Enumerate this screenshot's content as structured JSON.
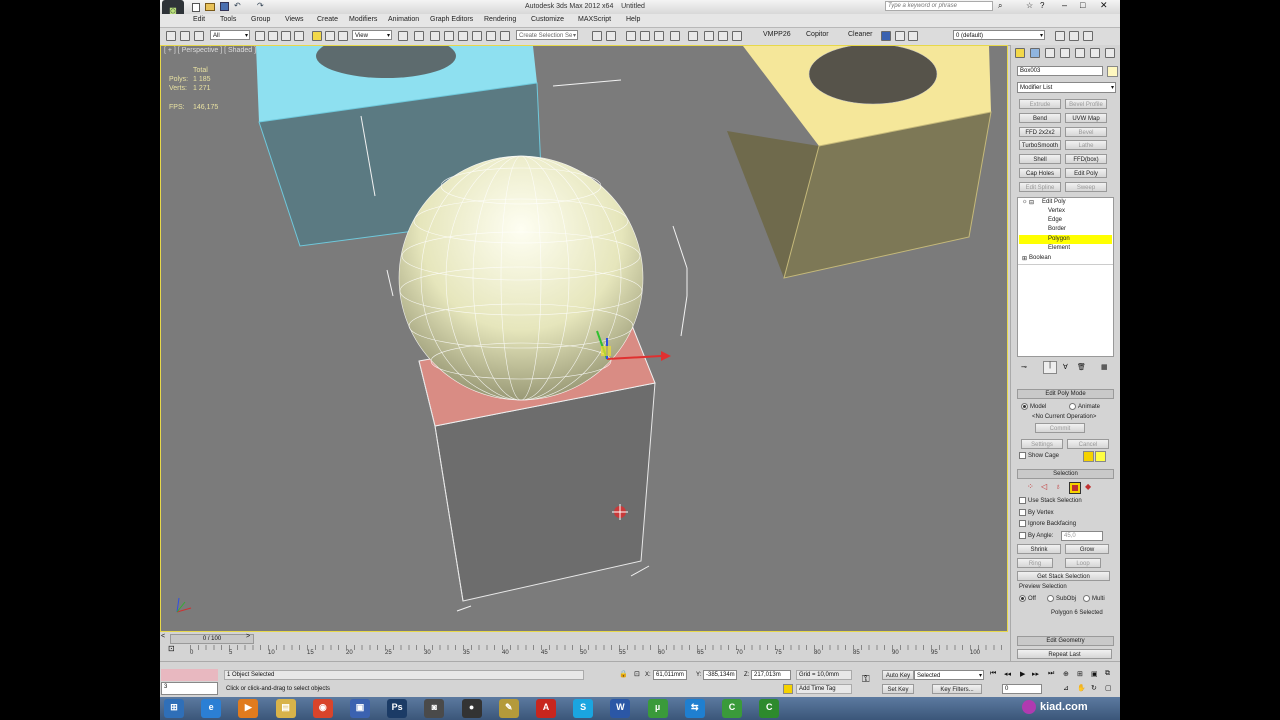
{
  "app": {
    "title": "Autodesk 3ds Max 2012 x64",
    "file": "Untitled",
    "search_placeholder": "Type a keyword or phrase"
  },
  "menu": [
    "Edit",
    "Tools",
    "Group",
    "Views",
    "Create",
    "Modifiers",
    "Animation",
    "Graph Editors",
    "Rendering",
    "Customize",
    "MAXScript",
    "Help"
  ],
  "toolbar": {
    "filter_value": "All",
    "refcoord_value": "View",
    "selection_set_placeholder": "Create Selection Se",
    "plugin_buttons": [
      "VMPP26",
      "Copitor",
      "Cleaner"
    ],
    "layer_value": "0 (default)"
  },
  "viewport": {
    "label": "[ + ] [ Perspective ] [ Shaded ]",
    "stats": {
      "total_label": "Total",
      "polys_label": "Polys:",
      "polys_value": "1 185",
      "verts_label": "Verts:",
      "verts_value": "1 271",
      "fps_label": "FPS:",
      "fps_value": "146,175"
    }
  },
  "command_panel": {
    "object_name": "Box003",
    "modifier_list_label": "Modifier List",
    "modifier_buttons": [
      {
        "label": "Extrude",
        "enabled": false
      },
      {
        "label": "Bevel Profile",
        "enabled": false
      },
      {
        "label": "Bend",
        "enabled": true
      },
      {
        "label": "UVW Map",
        "enabled": true
      },
      {
        "label": "FFD 2x2x2",
        "enabled": true
      },
      {
        "label": "Bevel",
        "enabled": false
      },
      {
        "label": "TurboSmooth",
        "enabled": true
      },
      {
        "label": "Lathe",
        "enabled": false
      },
      {
        "label": "Shell",
        "enabled": true
      },
      {
        "label": "FFD(box)",
        "enabled": true
      },
      {
        "label": "Cap Holes",
        "enabled": true
      },
      {
        "label": "Edit Poly",
        "enabled": true
      },
      {
        "label": "Edit Spline",
        "enabled": false
      },
      {
        "label": "Sweep",
        "enabled": false
      }
    ],
    "stack": {
      "root": "Edit Poly",
      "subobjects": [
        "Vertex",
        "Edge",
        "Border",
        "Polygon",
        "Element"
      ],
      "selected": "Polygon",
      "base": "Boolean"
    },
    "edit_poly_mode": {
      "title": "Edit Poly Mode",
      "model_label": "Model",
      "animate_label": "Animate",
      "operation": "<No Current Operation>",
      "commit": "Commit",
      "settings": "Settings",
      "cancel": "Cancel",
      "show_cage": "Show Cage"
    },
    "selection": {
      "title": "Selection",
      "use_stack": "Use Stack Selection",
      "by_vertex": "By Vertex",
      "ignore_backfacing": "Ignore Backfacing",
      "by_angle": "By Angle:",
      "angle_value": "45,0",
      "shrink": "Shrink",
      "grow": "Grow",
      "ring": "Ring",
      "loop": "Loop",
      "get_stack": "Get Stack Selection",
      "preview_title": "Preview Selection",
      "preview_off": "Off",
      "preview_subobj": "SubObj",
      "preview_multi": "Multi",
      "selected_count": "Polygon 6 Selected"
    },
    "edit_geometry": {
      "title": "Edit Geometry",
      "repeat_last": "Repeat Last"
    }
  },
  "timeline": {
    "slider_label": "0 / 100",
    "ticks": [
      "0",
      "5",
      "10",
      "15",
      "20",
      "25",
      "30",
      "35",
      "40",
      "45",
      "50",
      "55",
      "60",
      "65",
      "70",
      "75",
      "80",
      "85",
      "90",
      "95",
      "100"
    ]
  },
  "status": {
    "selected": "1 Object Selected",
    "prompt": "Click or click-and-drag to select objects",
    "x_label": "X:",
    "x_value": "61,011mm",
    "y_label": "Y:",
    "y_value": "-385,134m",
    "z_label": "Z:",
    "z_value": "217,013m",
    "grid": "Grid = 10,0mm",
    "add_time_tag": "Add Time Tag",
    "auto_key": "Auto Key",
    "set_key": "Set Key",
    "selected_value": "Selected",
    "key_filters": "Key Filters...",
    "frame_value": "0",
    "listener_value": "3"
  },
  "taskbar": {
    "apps": [
      {
        "name": "start-orb",
        "color": "#2f6fb8",
        "glyph": "⊞"
      },
      {
        "name": "ie",
        "color": "#2b7fd4",
        "glyph": "e"
      },
      {
        "name": "media-player",
        "color": "#e07b1e",
        "glyph": "▶"
      },
      {
        "name": "explorer",
        "color": "#d8b34a",
        "glyph": "▤"
      },
      {
        "name": "chrome",
        "color": "#d9442b",
        "glyph": "◉"
      },
      {
        "name": "save",
        "color": "#3b62b0",
        "glyph": "▣"
      },
      {
        "name": "photoshop",
        "color": "#1b3b66",
        "glyph": "Ps"
      },
      {
        "name": "3dsmax",
        "color": "#4a4a4a",
        "glyph": "◙"
      },
      {
        "name": "camera",
        "color": "#333",
        "glyph": "●"
      },
      {
        "name": "tool",
        "color": "#b49a3a",
        "glyph": "✎"
      },
      {
        "name": "acrobat",
        "color": "#c8261e",
        "glyph": "A"
      },
      {
        "name": "skype",
        "color": "#1aa5e0",
        "glyph": "S"
      },
      {
        "name": "word",
        "color": "#2b57a6",
        "glyph": "W"
      },
      {
        "name": "utorrent",
        "color": "#3a9a3a",
        "glyph": "µ"
      },
      {
        "name": "teamviewer",
        "color": "#1f7fd0",
        "glyph": "⇆"
      },
      {
        "name": "camtasia",
        "color": "#3a9a3a",
        "glyph": "C"
      },
      {
        "name": "camtasia-recorder",
        "color": "#2d8a2d",
        "glyph": "C"
      }
    ],
    "watermark": "kiad.com"
  },
  "colors": {
    "viewport_bg": "#7b7b7b",
    "cyan_box": "#8ee0f0",
    "yellow_box": "#f5e79a",
    "selected_polygon": "#d98c84",
    "stack_highlight": "#ffff00"
  }
}
